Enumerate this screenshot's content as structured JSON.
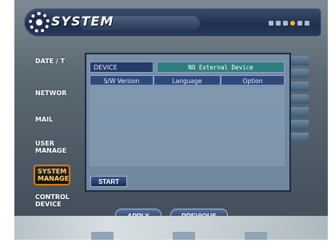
{
  "header": {
    "title": "SYSTEM"
  },
  "menu": {
    "items": [
      {
        "label": "DATE / T"
      },
      {
        "label": "NETWOR"
      },
      {
        "label": "MAIL"
      },
      {
        "label": "USER MANAGE"
      },
      {
        "label": "SYSTEM MANAGE",
        "active": true
      },
      {
        "label": "CONTROL DEVICE"
      }
    ]
  },
  "dialog": {
    "device_label": "DEVICE",
    "device_value": "NO External Device",
    "columns": [
      "S/W Version",
      "Language",
      "Option"
    ],
    "start_label": "START"
  },
  "footer": {
    "apply_label": "APPLY",
    "previous_label": "PREVIOUS"
  },
  "colors": {
    "header_bg": "#1f2f4e",
    "active_border": "#e07a00",
    "device_value_bg": "#2d7f7f"
  }
}
